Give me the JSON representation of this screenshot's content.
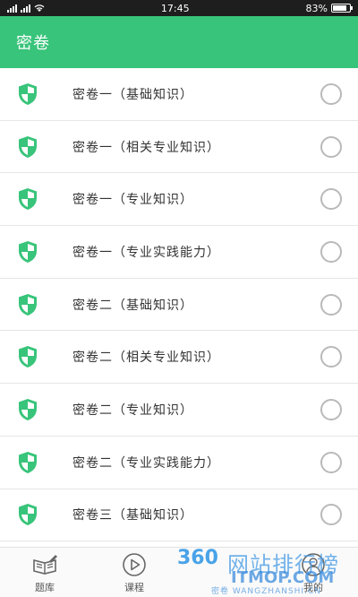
{
  "status_bar": {
    "time": "17:45",
    "battery": "83%",
    "battery_level": 0.83
  },
  "app_bar": {
    "title": "密卷"
  },
  "list": {
    "items": [
      {
        "label": "密卷一（基础知识）",
        "checked": false
      },
      {
        "label": "密卷一（相关专业知识）",
        "checked": false
      },
      {
        "label": "密卷一（专业知识）",
        "checked": false
      },
      {
        "label": "密卷一（专业实践能力）",
        "checked": false
      },
      {
        "label": "密卷二（基础知识）",
        "checked": false
      },
      {
        "label": "密卷二（相关专业知识）",
        "checked": false
      },
      {
        "label": "密卷二（专业知识）",
        "checked": false
      },
      {
        "label": "密卷二（专业实践能力）",
        "checked": false
      },
      {
        "label": "密卷三（基础知识）",
        "checked": false
      }
    ]
  },
  "tab_bar": {
    "tabs": [
      {
        "label": "题库",
        "icon": "book-pen-icon"
      },
      {
        "label": "课程",
        "icon": "play-circle-icon"
      },
      {
        "label": "",
        "icon": "tab-icon"
      },
      {
        "label": "我的",
        "icon": "user-icon"
      }
    ]
  },
  "watermark": {
    "logo": "360",
    "title": "网站排行榜",
    "domain": "ITMOP.COM",
    "sub": "密卷 WANGZHANSHI.CN"
  },
  "colors": {
    "accent": "#38c47a",
    "radio": "#b9b9b9"
  }
}
